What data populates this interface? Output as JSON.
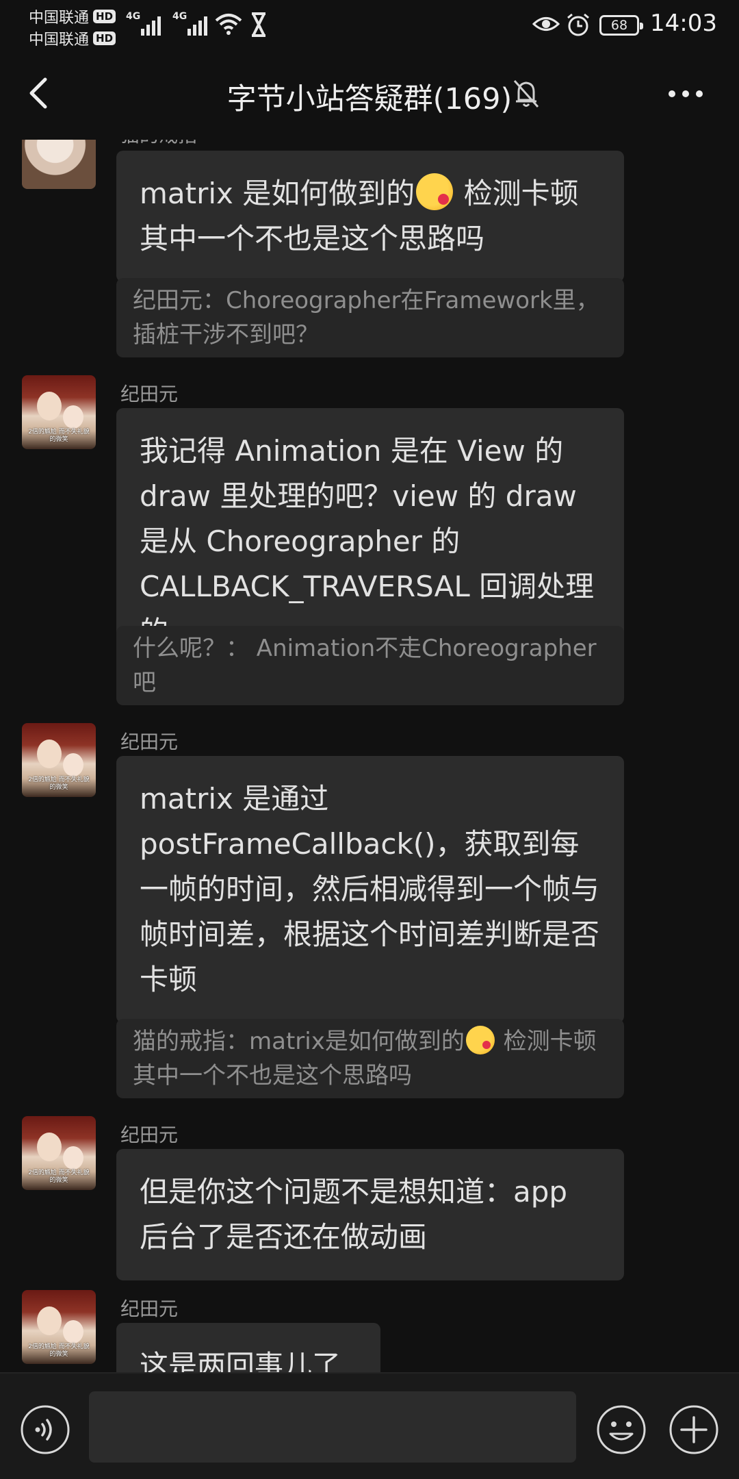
{
  "status_bar": {
    "carrier1": "中国联通",
    "carrier2": "中国联通",
    "hd": "HD",
    "net1": "4G",
    "net2": "4G",
    "battery": "68",
    "time": "14:03"
  },
  "header": {
    "title": "字节小站答疑群(169)"
  },
  "messages": {
    "m1": {
      "sender": "猫的戒指",
      "text_before_emoji": "matrix 是如何做到的",
      "text_after_emoji": " 检测卡顿其中一个不也是这个思路吗",
      "quote": "纪田元：Choreographer在Framework里，插桩干涉不到吧？"
    },
    "m2": {
      "sender": "纪田元",
      "text": "我记得 Animation 是在 View 的 draw 里处理的吧？view 的 draw 是从 Choreographer 的 CALLBACK_TRAVERSAL 回调处理的",
      "quote": "什么呢？： Animation不走Choreographer吧"
    },
    "m3": {
      "sender": "纪田元",
      "text": "matrix 是通过 postFrameCallback()，获取到每一帧的时间，然后相减得到一个帧与帧时间差，根据这个时间差判断是否卡顿",
      "quote_before_emoji": "猫的戒指：matrix是如何做到的",
      "quote_after_emoji": " 检测卡顿其中一个不也是这个思路吗"
    },
    "m4": {
      "sender": "纪田元",
      "text": "但是你这个问题不是想知道：app 后台了是否还在做动画"
    },
    "m5": {
      "sender": "纪田元",
      "text": "这是两回事儿了"
    }
  },
  "avatar_caption": "2倍的尴尬 而不失礼貌的微笑",
  "input": {
    "placeholder": ""
  },
  "icons": {
    "back": "chevron-left-icon",
    "mute": "bell-off-icon",
    "more": "more-dots-icon",
    "voice": "voice-icon",
    "emoji": "smiley-icon",
    "plus": "plus-icon"
  },
  "colors": {
    "background": "#111111",
    "bubble": "#2c2c2c",
    "quote": "#262626",
    "text": "#e2e2e2",
    "muted": "#8f8f8f"
  }
}
